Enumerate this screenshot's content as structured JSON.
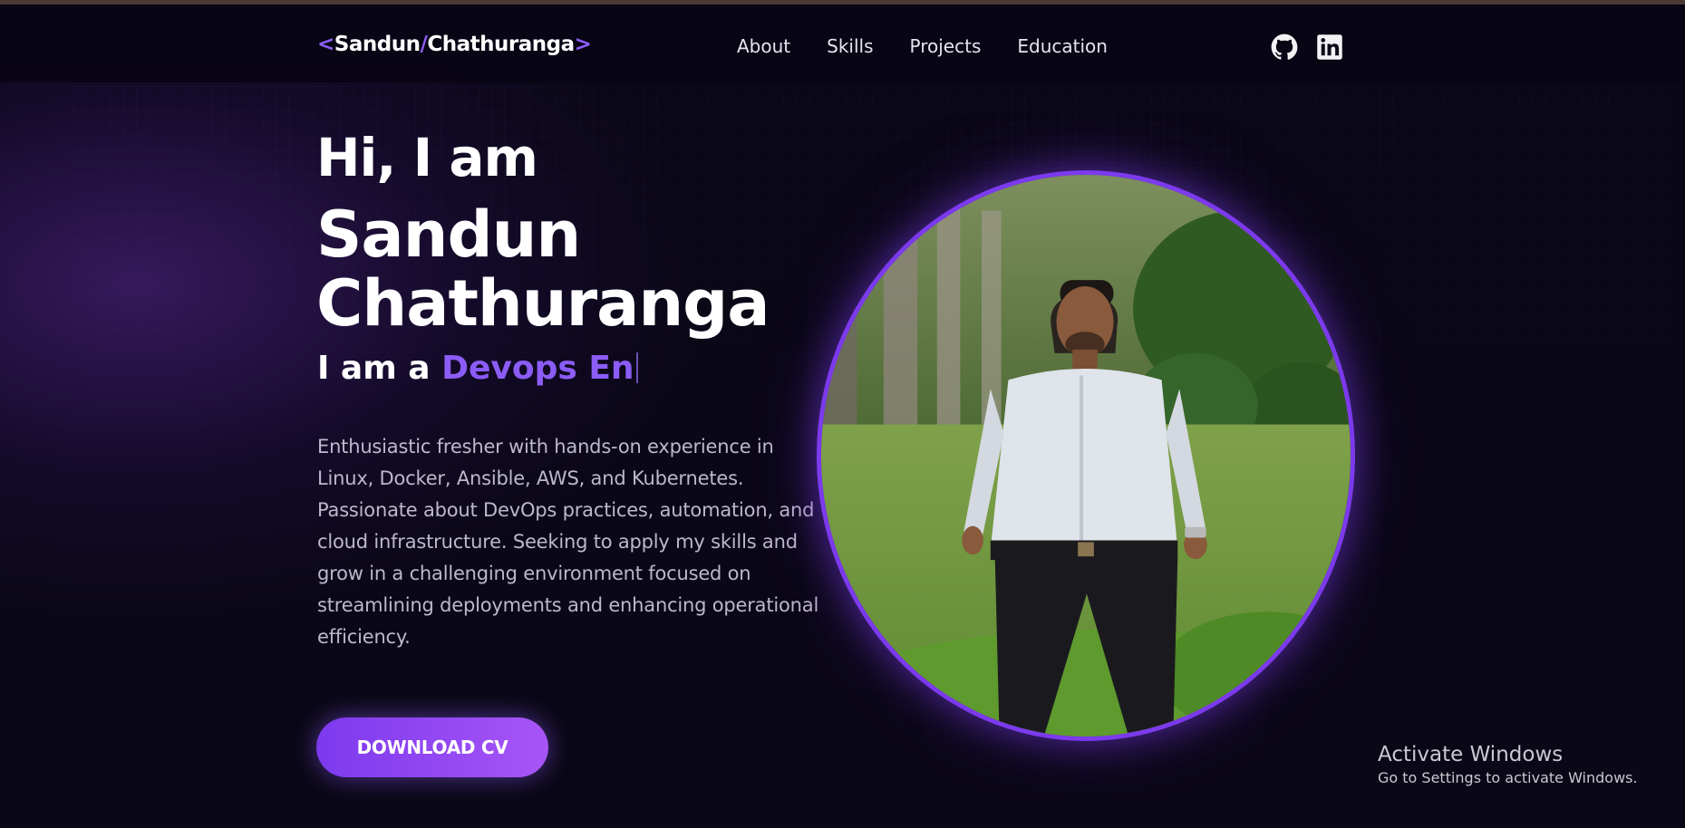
{
  "nav": {
    "logo": {
      "open": "<",
      "first": "Sandun",
      "slash": "/",
      "last": "Chathuranga",
      "close": ">"
    },
    "links": [
      "About",
      "Skills",
      "Projects",
      "Education"
    ],
    "social": [
      {
        "icon": "github-icon"
      },
      {
        "icon": "linkedin-icon"
      }
    ]
  },
  "hero": {
    "greeting": "Hi, I am",
    "first_name": "Sandun",
    "last_name": "Chathuranga",
    "role_prefix": "I am a",
    "role_typed": "Devops En",
    "description": "Enthusiastic fresher with hands-on experience in Linux, Docker, Ansible, AWS, and Kubernetes. Passionate about DevOps practices, automation, and cloud infrastructure. Seeking to apply my skills and grow in a challenging environment focused on streamlining deployments and enhancing operational efficiency.",
    "cv_button": "DOWNLOAD CV"
  },
  "watermark": {
    "title": "Activate Windows",
    "subtitle": "Go to Settings to activate Windows."
  },
  "colors": {
    "background": "#0a0716",
    "accent": "#8b5cf6",
    "button_start": "#7c3aed",
    "button_end": "#a855f7"
  }
}
